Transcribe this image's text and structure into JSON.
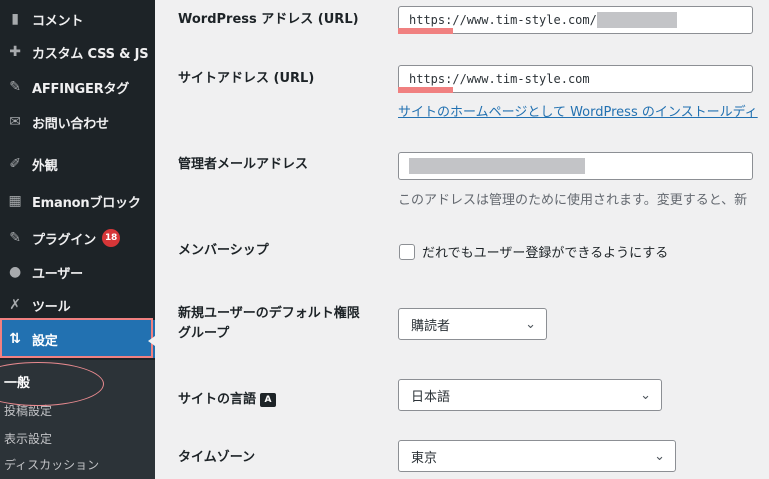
{
  "sidebar": {
    "items": [
      {
        "label": "コメント",
        "icon": "comment-icon",
        "glyph": "▮"
      },
      {
        "label": "カスタム CSS & JS",
        "icon": "plus-circle-icon",
        "glyph": "✚"
      },
      {
        "label": "AFFINGERタグ",
        "icon": "pin-icon",
        "glyph": "✎"
      },
      {
        "label": "お問い合わせ",
        "icon": "mail-icon",
        "glyph": "✉"
      },
      {
        "label": "外観",
        "icon": "brush-icon",
        "glyph": "✐"
      },
      {
        "label": "Emanonブロック",
        "icon": "grid-icon",
        "glyph": "▦"
      },
      {
        "label": "プラグイン",
        "icon": "plugin-icon",
        "glyph": "✎",
        "badge": "18"
      },
      {
        "label": "ユーザー",
        "icon": "user-icon",
        "glyph": "●"
      },
      {
        "label": "ツール",
        "icon": "wrench-icon",
        "glyph": "✗"
      },
      {
        "label": "設定",
        "icon": "settings-icon",
        "glyph": "⇅"
      }
    ],
    "submenu": [
      "一般",
      "投稿設定",
      "表示設定",
      "ディスカッション"
    ]
  },
  "form": {
    "wp_address": {
      "label": "WordPress アドレス (URL)",
      "value": "https://www.tim-style.com/"
    },
    "site_address": {
      "label": "サイトアドレス (URL)",
      "value": "https://www.tim-style.com",
      "description": "サイトのホームページとして WordPress のインストールディ"
    },
    "admin_email": {
      "label": "管理者メールアドレス",
      "description": "このアドレスは管理のために使用されます。変更すると、新"
    },
    "membership": {
      "label": "メンバーシップ",
      "checkbox_label": "だれでもユーザー登録ができるようにする"
    },
    "default_role": {
      "label_line1": "新規ユーザーのデフォルト権限",
      "label_line2": "グループ",
      "value": "購読者"
    },
    "site_language": {
      "label": "サイトの言語",
      "value": "日本語"
    },
    "timezone": {
      "label": "タイムゾーン",
      "value": "東京"
    }
  },
  "colors": {
    "accent": "#2271b1",
    "highlight": "#f08080",
    "sidebar_bg": "#1d2327",
    "badge": "#d63638"
  }
}
